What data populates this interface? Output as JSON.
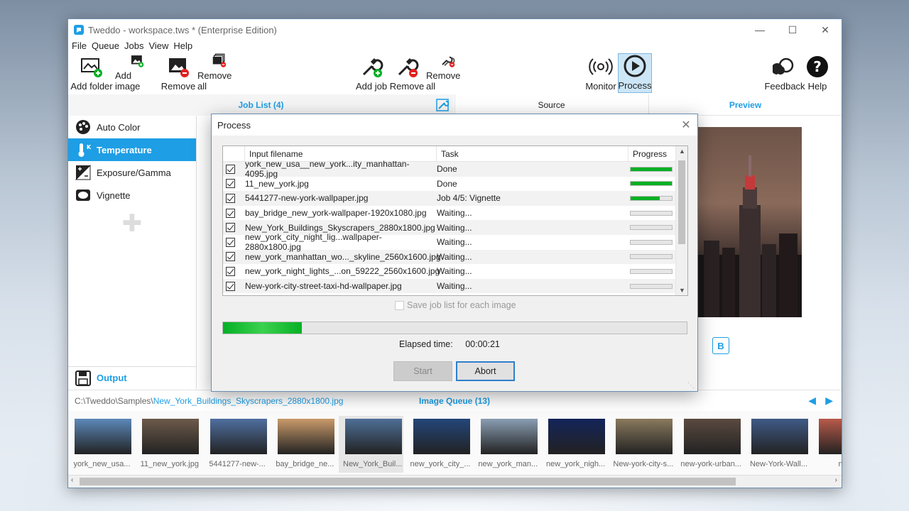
{
  "window": {
    "title": "Tweddo - workspace.tws * (Enterprise Edition)",
    "min_icon": "minimize-icon",
    "max_icon": "maximize-icon",
    "close_icon": "close-icon"
  },
  "menu": [
    "File",
    "Queue",
    "Jobs",
    "View",
    "Help"
  ],
  "toolbar": {
    "add_folder": "Add folder",
    "add_image": "Add image",
    "remove": "Remove",
    "remove_all": "Remove all",
    "add_job": "Add job",
    "remove_job": "Remove",
    "remove_all_jobs": "Remove all",
    "monitor": "Monitor",
    "process": "Process",
    "feedback": "Feedback",
    "help": "Help"
  },
  "tabs": {
    "job_list": "Job List (4)",
    "source": "Source",
    "preview": "Preview"
  },
  "jobs": [
    {
      "label": "Auto Color",
      "icon": "palette-icon"
    },
    {
      "label": "Temperature",
      "icon": "thermometer-icon"
    },
    {
      "label": "Exposure/Gamma",
      "icon": "exposure-icon"
    },
    {
      "label": "Vignette",
      "icon": "vignette-icon"
    }
  ],
  "output_label": "Output",
  "preview_b_label": "B",
  "path": {
    "prefix": "C:\\Tweddo\\Samples\\",
    "file": "New_York_Buildings_Skyscrapers_2880x1800.jpg"
  },
  "queue_label": "Image Queue (13)",
  "thumbnails": [
    {
      "caption": "york_new_usa...",
      "color": "#5c88b8"
    },
    {
      "caption": "11_new_york.jpg",
      "color": "#6d5a4a"
    },
    {
      "caption": "5441277-new-...",
      "color": "#4f6fa0"
    },
    {
      "caption": "bay_bridge_ne...",
      "color": "#c99a6a"
    },
    {
      "caption": "New_York_Buil...",
      "color": "#4e6f96"
    },
    {
      "caption": "new_york_city_...",
      "color": "#23467a"
    },
    {
      "caption": "new_york_man...",
      "color": "#8a9eb3"
    },
    {
      "caption": "new_york_nigh...",
      "color": "#14245a"
    },
    {
      "caption": "New-york-city-s...",
      "color": "#8a7a5e"
    },
    {
      "caption": "new-york-urban...",
      "color": "#5a4a40"
    },
    {
      "caption": "New-York-Wall...",
      "color": "#3f5a86"
    },
    {
      "caption": "nurZ",
      "color": "#b85a4a"
    }
  ],
  "dialog": {
    "title": "Process",
    "columns": {
      "filename": "Input filename",
      "task": "Task",
      "progress": "Progress"
    },
    "rows": [
      {
        "file": "york_new_usa__new_york...ity_manhattan-4095.jpg",
        "task": "Done",
        "progress": 1.0
      },
      {
        "file": "11_new_york.jpg",
        "task": "Done",
        "progress": 1.0
      },
      {
        "file": "5441277-new-york-wallpaper.jpg",
        "task": "Job 4/5: Vignette",
        "progress": 0.7
      },
      {
        "file": "bay_bridge_new_york-wallpaper-1920x1080.jpg",
        "task": "Waiting...",
        "progress": 0
      },
      {
        "file": "New_York_Buildings_Skyscrapers_2880x1800.jpg",
        "task": "Waiting...",
        "progress": 0
      },
      {
        "file": "new_york_city_night_lig...wallpaper-2880x1800.jpg",
        "task": "Waiting...",
        "progress": 0
      },
      {
        "file": "new_york_manhattan_wo..._skyline_2560x1600.jpg",
        "task": "Waiting...",
        "progress": 0
      },
      {
        "file": "new_york_night_lights_...on_59222_2560x1600.jpg",
        "task": "Waiting...",
        "progress": 0
      },
      {
        "file": "New-york-city-street-taxi-hd-wallpaper.jpg",
        "task": "Waiting...",
        "progress": 0
      }
    ],
    "save_label": "Save job list for each image",
    "overall_progress": 0.17,
    "elapsed_label": "Elapsed time:",
    "elapsed_value": "00:00:21",
    "start_label": "Start",
    "abort_label": "Abort"
  }
}
